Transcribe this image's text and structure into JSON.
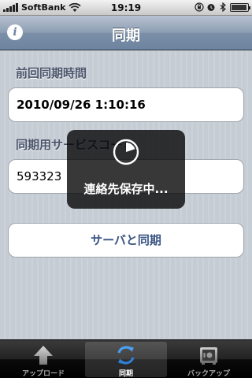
{
  "status_bar": {
    "carrier": "SoftBank",
    "time": "19:19"
  },
  "nav": {
    "title": "同期",
    "info_icon": "info-icon"
  },
  "last_sync": {
    "label": "前回同期時間",
    "value": "2010/09/26  1:10:16"
  },
  "sync_code": {
    "label": "同期用サービスコード",
    "value": "593323"
  },
  "sync_button": {
    "label": "サーバと同期"
  },
  "hud": {
    "message": "連絡先保存中...",
    "icon": "progress-pie-icon"
  },
  "tabs": [
    {
      "label": "アップロード",
      "icon": "upload-arrow-icon",
      "active": false
    },
    {
      "label": "同期",
      "icon": "sync-arrows-icon",
      "active": true
    },
    {
      "label": "バックアップ",
      "icon": "safe-icon",
      "active": false
    }
  ],
  "colors": {
    "nav_gradient_top": "#b7c3d1",
    "nav_gradient_bottom": "#6d84a0",
    "section_label": "#4c566c",
    "button_text": "#3a5483",
    "sync_icon": "#3f8fe0"
  }
}
